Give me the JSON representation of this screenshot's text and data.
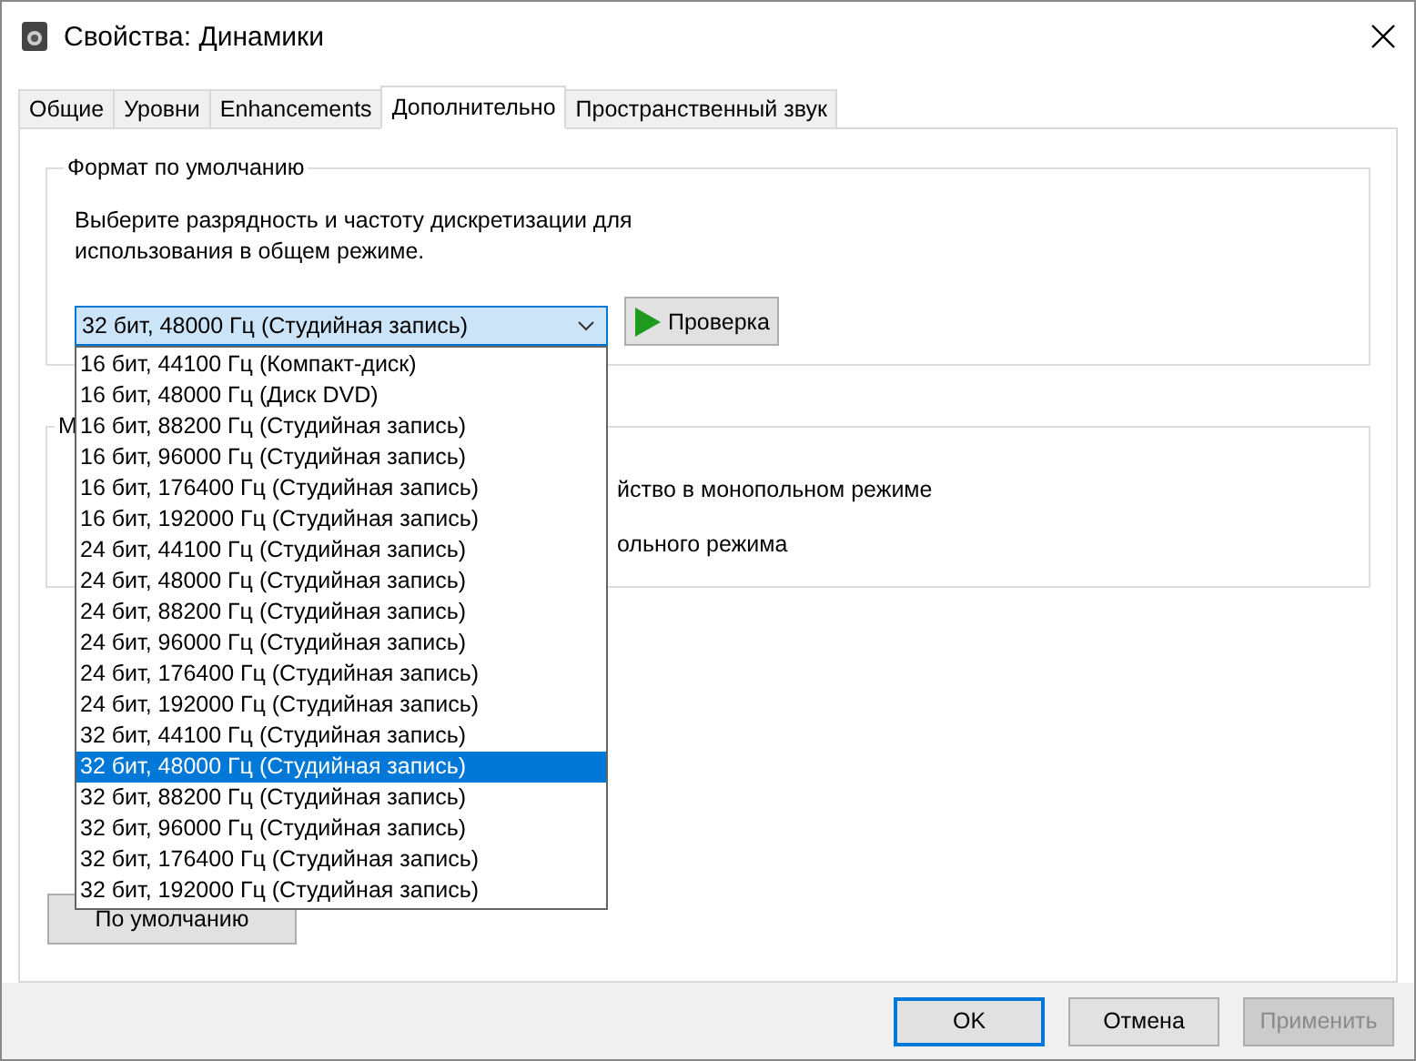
{
  "window": {
    "title": "Свойства: Динамики"
  },
  "tabs": [
    {
      "label": "Общие",
      "selected": false
    },
    {
      "label": "Уровни",
      "selected": false
    },
    {
      "label": "Enhancements",
      "selected": false
    },
    {
      "label": "Дополнительно",
      "selected": true
    },
    {
      "label": "Пространственный звук",
      "selected": false
    }
  ],
  "default_format": {
    "title": "Формат по умолчанию",
    "description_lines": [
      "Выберите разрядность и частоту дискретизации для",
      "использования в общем режиме."
    ],
    "combo": {
      "value": "32 бит, 48000 Гц (Студийная запись)",
      "expanded": true,
      "options": [
        {
          "label": "16 бит, 44100 Гц (Компакт-диск)",
          "selected": false
        },
        {
          "label": "16 бит, 48000 Гц (Диск DVD)",
          "selected": false
        },
        {
          "label": "16 бит, 88200 Гц (Студийная запись)",
          "selected": false
        },
        {
          "label": "16 бит, 96000 Гц (Студийная запись)",
          "selected": false
        },
        {
          "label": "16 бит, 176400 Гц (Студийная запись)",
          "selected": false
        },
        {
          "label": "16 бит, 192000 Гц (Студийная запись)",
          "selected": false
        },
        {
          "label": "24 бит, 44100 Гц (Студийная запись)",
          "selected": false
        },
        {
          "label": "24 бит, 48000 Гц (Студийная запись)",
          "selected": false
        },
        {
          "label": "24 бит, 88200 Гц (Студийная запись)",
          "selected": false
        },
        {
          "label": "24 бит, 96000 Гц (Студийная запись)",
          "selected": false
        },
        {
          "label": "24 бит, 176400 Гц (Студийная запись)",
          "selected": false
        },
        {
          "label": "24 бит, 192000 Гц (Студийная запись)",
          "selected": false
        },
        {
          "label": "32 бит, 44100 Гц (Студийная запись)",
          "selected": false
        },
        {
          "label": "32 бит, 48000 Гц (Студийная запись)",
          "selected": true
        },
        {
          "label": "32 бит, 88200 Гц (Студийная запись)",
          "selected": false
        },
        {
          "label": "32 бит, 96000 Гц (Студийная запись)",
          "selected": false
        },
        {
          "label": "32 бит, 176400 Гц (Студийная запись)",
          "selected": false
        },
        {
          "label": "32 бит, 192000 Гц (Студийная запись)",
          "selected": false
        }
      ]
    },
    "test_button": "Проверка"
  },
  "exclusive_mode": {
    "title": "M",
    "lines": [
      "йство в монопольном режиме",
      "ольного режима"
    ]
  },
  "restore_button": "По умолчанию",
  "buttons": [
    {
      "label": "OK",
      "kind": "default"
    },
    {
      "label": "Отмена",
      "kind": "normal"
    },
    {
      "label": "Применить",
      "kind": "disabled"
    }
  ]
}
